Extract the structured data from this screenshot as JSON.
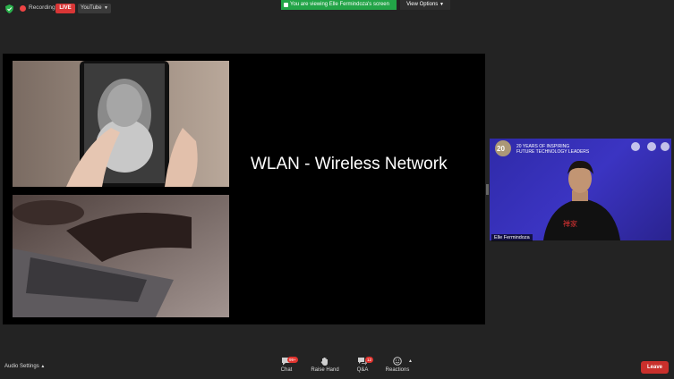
{
  "topbar": {
    "recording_label": "Recording",
    "live_badge": "LIVE",
    "youtube_label": "YouTube",
    "viewing_banner": "You are viewing Elle Fermindoza's screen",
    "view_options": "View Options"
  },
  "slide": {
    "title": "WLAN - Wireless Network"
  },
  "camera": {
    "banner_line1": "20 YEARS OF INSPIRING",
    "banner_line2": "FUTURE TECHNOLOGY LEADERS",
    "participant_name": "Elle Fermindoza"
  },
  "toolbar": {
    "audio_settings": "Audio Settings",
    "chat_label": "Chat",
    "chat_badge": "99+",
    "raise_hand_label": "Raise Hand",
    "qa_label": "Q&A",
    "qa_badge": "12",
    "reactions_label": "Reactions",
    "leave_label": "Leave"
  },
  "colors": {
    "background": "#232323",
    "live_red": "#d93636",
    "viewing_green": "#22a447",
    "leave_red": "#c9302c",
    "camera_bg": "#3b34c2"
  }
}
